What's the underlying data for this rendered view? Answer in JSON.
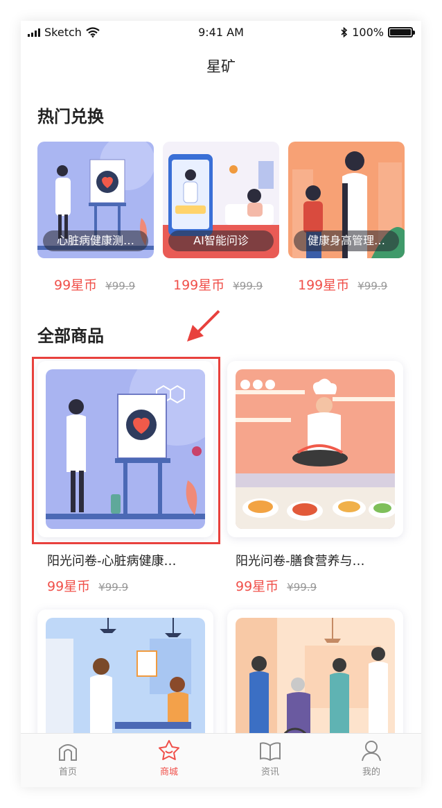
{
  "status": {
    "carrier": "Sketch",
    "time": "9:41 AM",
    "battery": "100%"
  },
  "nav": {
    "title": "星矿"
  },
  "hot": {
    "title": "热门兑换",
    "items": [
      {
        "label": "心脏病健康测…",
        "price": "99星币",
        "original": "¥99.9"
      },
      {
        "label": "AI智能问诊",
        "price": "199星币",
        "original": "¥99.9"
      },
      {
        "label": "健康身高管理…",
        "price": "199星币",
        "original": "¥99.9"
      }
    ]
  },
  "all": {
    "title": "全部商品",
    "items": [
      {
        "name": "阳光问卷-心脏病健康…",
        "price": "99星币",
        "original": "¥99.9"
      },
      {
        "name": "阳光问卷-膳食营养与…",
        "price": "99星币",
        "original": "¥99.9"
      }
    ]
  },
  "tabs": [
    {
      "label": "首页",
      "icon": "home-icon"
    },
    {
      "label": "商城",
      "icon": "star-icon"
    },
    {
      "label": "资讯",
      "icon": "book-icon"
    },
    {
      "label": "我的",
      "icon": "person-icon"
    }
  ],
  "colors": {
    "accent": "#f0504a",
    "highlight_box": "#e8413d"
  }
}
